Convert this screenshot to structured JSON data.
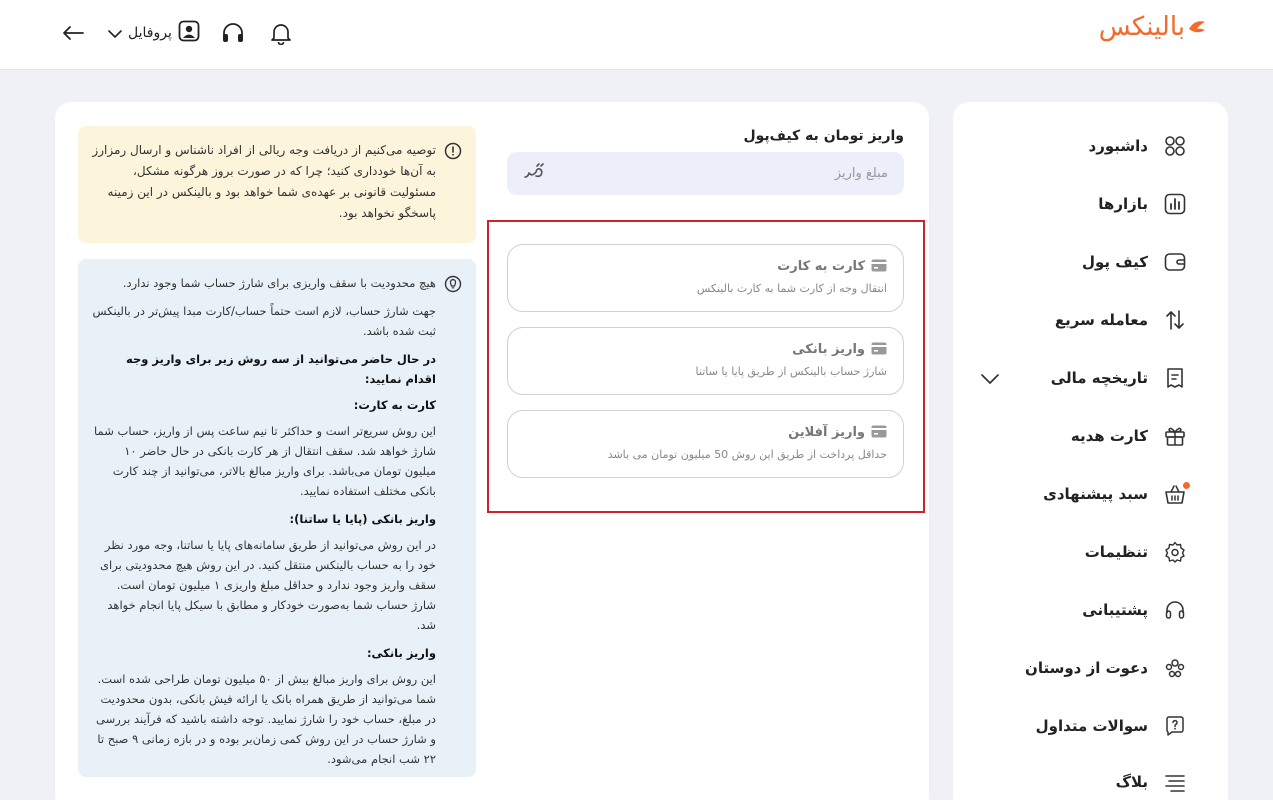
{
  "header": {
    "logo_text": "بالینکس",
    "profile_label": "پروفایل"
  },
  "sidebar": {
    "items": [
      {
        "label": "داشبورد",
        "icon": "dashboard-icon"
      },
      {
        "label": "بازارها",
        "icon": "markets-icon"
      },
      {
        "label": "کیف پول",
        "icon": "wallet-icon"
      },
      {
        "label": "معامله سریع",
        "icon": "swap-arrows-icon"
      },
      {
        "label": "تاریخچه مالی",
        "icon": "receipt-icon"
      },
      {
        "label": "کارت هدیه",
        "icon": "gift-icon"
      },
      {
        "label": "سبد پیشنهادی",
        "icon": "basket-icon"
      },
      {
        "label": "تنظیمات",
        "icon": "gear-icon"
      },
      {
        "label": "پشتیبانی",
        "icon": "headset-icon"
      },
      {
        "label": "دعوت از دوستان",
        "icon": "users-icon"
      },
      {
        "label": "سوالات متداول",
        "icon": "question-bubble-icon"
      },
      {
        "label": "بلاگ",
        "icon": "blog-lines-icon"
      }
    ]
  },
  "deposit": {
    "title": "واریز تومان به کیف‌پول",
    "amount_placeholder": "مبلغ واریز",
    "currency_mark": "تومان"
  },
  "methods": [
    {
      "title": "کارت به کارت",
      "subtitle": "انتقال وجه از کارت شما به کارت بالینکس"
    },
    {
      "title": "واریز بانکی",
      "subtitle": "شارژ حساب بالینکس از طریق پایا یا ساتنا"
    },
    {
      "title": "واریز آفلاین",
      "subtitle": "حداقل پرداخت از طریق این روش 50 میلیون تومان می باشد"
    }
  ],
  "warning": {
    "text": "توصیه می‌کنیم از دریافت وجه ریالی از افراد ناشناس و ارسال رمزارز به آن‌ها خودداری کنید؛ چرا که در صورت بروز هرگونه مشکل، مسئولیت قانونی بر عهده‌ی شما خواهد بود و بالینکس در این زمینه پاسخگو نخواهد بود."
  },
  "info": {
    "p1": "هیچ محدودیت با سقف واریزی برای شارژ حساب شما وجود ندارد.",
    "p2": "جهت شارژ حساب، لازم است حتماً حساب/کارت مبدا پیش‌تر در بالینکس ثبت شده باشد.",
    "h1": "در حال حاضر می‌توانید از سه روش زیر برای واریز وجه اقدام نمایید:",
    "h2": "کارت به کارت:",
    "p3": "این روش سریع‌تر است و حداکثر تا نیم ساعت پس از واریز، حساب شما شارژ خواهد شد. سقف انتقال از هر کارت بانکی در حال حاضر ۱۰ میلیون تومان می‌باشد. برای واریز مبالغ بالاتر، می‌توانید از چند کارت بانکی مختلف استفاده نمایید.",
    "h3": "واریز بانکی (پایا یا ساتنا):",
    "p4": "در این روش می‌توانید از طریق سامانه‌های پایا یا ساتنا، وجه مورد نظر خود را به حساب بالینکس منتقل کنید. در این روش هیچ محدودیتی برای سقف واریز وجود ندارد و حداقل مبلغ واریزی ۱ میلیون تومان است. شارژ حساب شما به‌صورت خودکار و مطابق با سیکل پایا انجام خواهد شد.",
    "h4": "واریز بانکی:",
    "p5": "این روش برای واریز مبالغ بیش از ۵۰ میلیون تومان طراحی شده است. شما می‌توانید از طریق همراه بانک یا ارائه فیش بانکی، بدون محدودیت در مبلغ، حساب خود را شارژ نمایید. توجه داشته باشید که فرآیند بررسی و شارژ حساب در این روش کمی زمان‌بر بوده و در بازه زمانی ۹ صبح تا ۲۲ شب انجام می‌شود."
  },
  "colors": {
    "brand": "#f26b2c",
    "highlight": "#d0202a",
    "warning_bg": "#fdf4dc",
    "info_bg": "#e8f1f8"
  }
}
